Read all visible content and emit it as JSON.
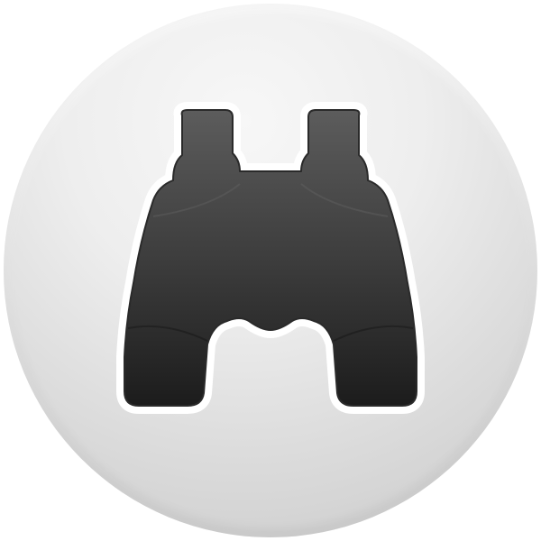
{
  "icon": {
    "name": "binoculars-icon",
    "colors": {
      "circle_light": "#f5f5f5",
      "circle_dark": "#c8c8c8",
      "glyph_top": "#5a5a5a",
      "glyph_bottom": "#1e1e1e",
      "glyph_outline": "#ffffff"
    }
  }
}
